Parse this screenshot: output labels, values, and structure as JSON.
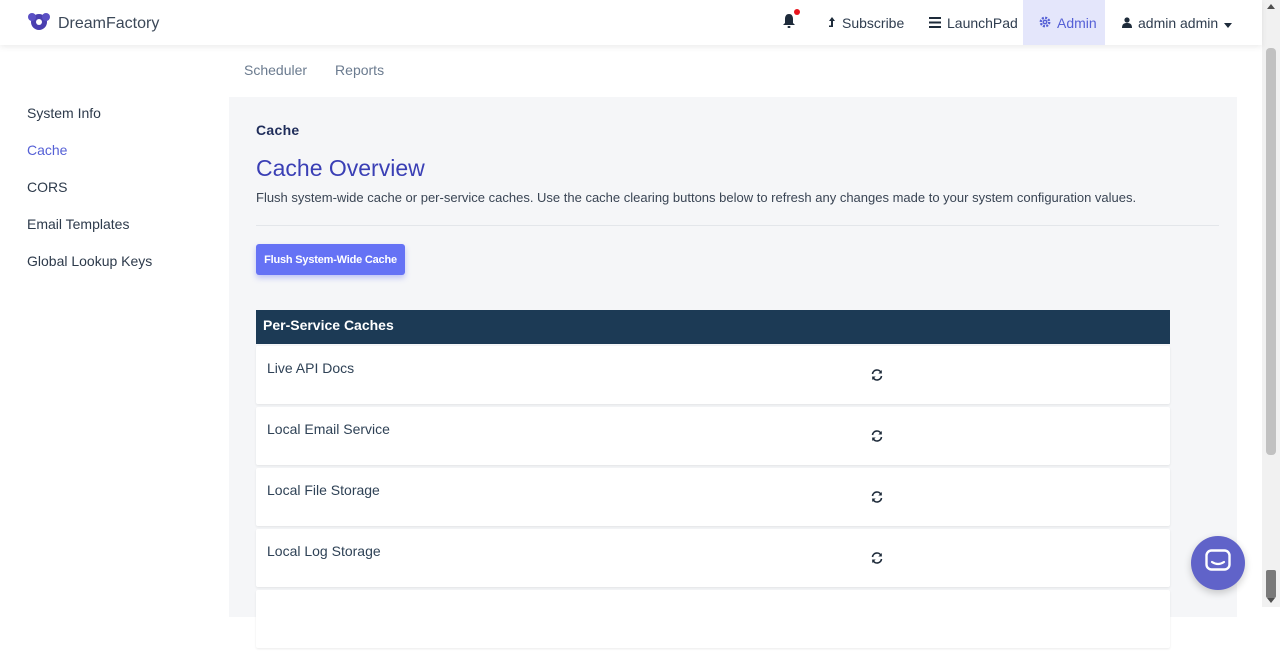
{
  "header": {
    "brand": "DreamFactory",
    "nav": {
      "subscribe": "Subscribe",
      "launchpad": "LaunchPad",
      "admin": "Admin",
      "user": "admin admin"
    }
  },
  "subtabs": [
    "Scheduler",
    "Reports"
  ],
  "sidebar": {
    "items": [
      {
        "label": "System Info"
      },
      {
        "label": "Cache"
      },
      {
        "label": "CORS"
      },
      {
        "label": "Email Templates"
      },
      {
        "label": "Global Lookup Keys"
      }
    ],
    "active_index": 1
  },
  "main": {
    "section_label": "Cache",
    "title": "Cache Overview",
    "description": "Flush system-wide cache or per-service caches. Use the cache clearing buttons below to refresh any changes made to your system configuration values.",
    "flush_button": "Flush System-Wide Cache",
    "table_header": "Per-Service Caches",
    "services": [
      {
        "name": "Live API Docs"
      },
      {
        "name": "Local Email Service"
      },
      {
        "name": "Local File Storage"
      },
      {
        "name": "Local Log Storage"
      }
    ]
  },
  "colors": {
    "accent": "#5560d6",
    "table_header_bg": "#1c3a55",
    "flush_button_bg": "#6572f5",
    "notification_dot": "#e8131c"
  },
  "icons": {
    "brand": "dreamfactory-logo-icon",
    "notifications": "bell-icon",
    "subscribe": "upload-arrow-icon",
    "launchpad": "bars-icon",
    "admin": "gear-icon",
    "user": "user-icon",
    "refresh": "refresh-icon",
    "chat": "chat-icon"
  }
}
